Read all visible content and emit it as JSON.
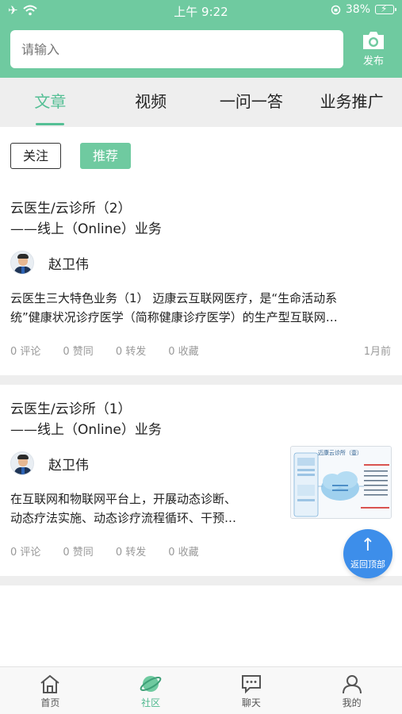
{
  "status_bar": {
    "time": "上午 9:22",
    "battery": "38%"
  },
  "search": {
    "placeholder": "请输入"
  },
  "publish": {
    "label": "发布"
  },
  "tabs": [
    {
      "label": "文章",
      "active": true
    },
    {
      "label": "视频",
      "active": false
    },
    {
      "label": "一问一答",
      "active": false
    },
    {
      "label": "业务推广",
      "active": false
    }
  ],
  "filters": {
    "follow": "关注",
    "recommend": "推荐"
  },
  "posts": [
    {
      "title_line1": "云医生/云诊所（2）",
      "title_line2": "——线上（Online）业务",
      "author": "赵卫伟",
      "excerpt_line1": "云医生三大特色业务（1） 迈康云互联网医疗，是“生命活动系",
      "excerpt_line2": "统”健康状况诊疗医学（简称健康诊疗医学）的生产型互联网…",
      "comments": "0 评论",
      "likes": "0 赞同",
      "shares": "0 转发",
      "favorites": "0 收藏",
      "time": "1月前"
    },
    {
      "title_line1": "云医生/云诊所（1）",
      "title_line2": "——线上（Online）业务",
      "author": "赵卫伟",
      "excerpt_line1": "在互联网和物联网平台上，开展动态诊断、",
      "excerpt_line2": "动态疗法实施、动态诊疗流程循环、干预…",
      "comments": "0 评论",
      "likes": "0 赞同",
      "shares": "0 转发",
      "favorites": "0 收藏",
      "thumbnail_title": "迈康云诊所（壹）"
    }
  ],
  "back_to_top": {
    "label": "返回顶部"
  },
  "bottom_nav": [
    {
      "label": "首页",
      "icon": "home-icon",
      "active": false
    },
    {
      "label": "社区",
      "icon": "community-icon",
      "active": true
    },
    {
      "label": "聊天",
      "icon": "chat-icon",
      "active": false
    },
    {
      "label": "我的",
      "icon": "profile-icon",
      "active": false
    }
  ],
  "colors": {
    "brand": "#6fcaa0",
    "active_tab": "#55bf95",
    "back_to_top": "#3d8eea",
    "meta_text": "#999999"
  }
}
